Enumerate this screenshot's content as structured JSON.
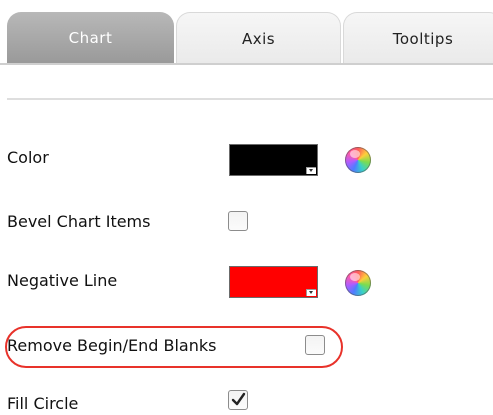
{
  "tabs": [
    {
      "label": "Chart",
      "active": true
    },
    {
      "label": "Axis",
      "active": false
    },
    {
      "label": "Tooltips",
      "active": false
    }
  ],
  "rows": {
    "color": {
      "label": "Color",
      "swatch_color": "#000000",
      "icon": "color-wheel-icon"
    },
    "bevel": {
      "label": "Bevel Chart Items",
      "checked": false
    },
    "negative_line": {
      "label": "Negative Line",
      "swatch_color": "#ff0000",
      "icon": "color-wheel-icon"
    },
    "remove_blanks": {
      "label": "Remove Begin/End Blanks",
      "checked": false,
      "highlighted": true,
      "highlight_color": "#e8322a"
    },
    "fill_circle": {
      "label": "Fill Circle",
      "checked": true
    }
  },
  "colors": {
    "active_tab": "#a8a8a8",
    "inactive_tab": "#f0f0f0"
  }
}
